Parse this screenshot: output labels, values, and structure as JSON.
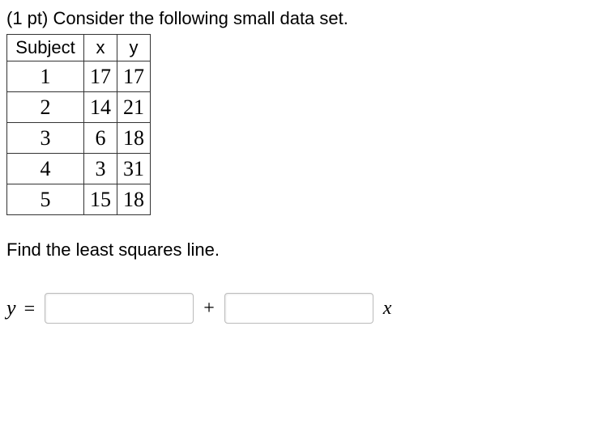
{
  "prompt": "(1 pt) Consider the following small data set.",
  "table": {
    "headers": {
      "subject": "Subject",
      "x": "x",
      "y": "y"
    },
    "rows": [
      {
        "subject": "1",
        "x": "17",
        "y": "17"
      },
      {
        "subject": "2",
        "x": "14",
        "y": "21"
      },
      {
        "subject": "3",
        "x": "6",
        "y": "18"
      },
      {
        "subject": "4",
        "x": "3",
        "y": "31"
      },
      {
        "subject": "5",
        "x": "15",
        "y": "18"
      }
    ]
  },
  "question": "Find the least squares line.",
  "equation": {
    "y_label": "y",
    "equals": "=",
    "plus": "+",
    "x_label": "x",
    "intercept_value": "",
    "slope_value": ""
  }
}
